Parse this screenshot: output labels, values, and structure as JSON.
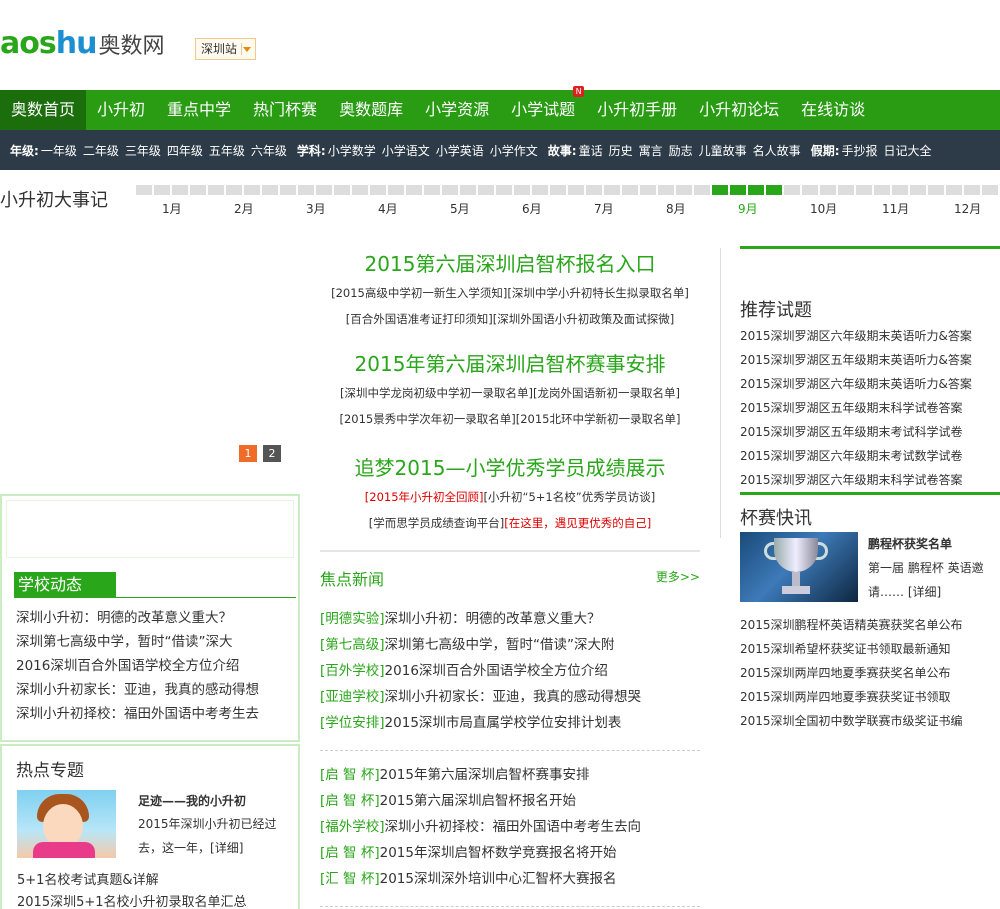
{
  "header": {
    "logo_en_a": "aos",
    "logo_en_b": "hu",
    "logo_cn": "奥数网",
    "station": "深圳站"
  },
  "nav": {
    "items": [
      "奥数首页",
      "小升初",
      "重点中学",
      "热门杯赛",
      "奥数题库",
      "小学资源",
      "小学试题",
      "小升初手册",
      "小升初论坛",
      "在线访谈"
    ],
    "badge": "N"
  },
  "subnav": {
    "grade_label": "年级:",
    "grades": [
      "一年级",
      "二年级",
      "三年级",
      "四年级",
      "五年级",
      "六年级"
    ],
    "subject_label": "学科:",
    "subjects": [
      "小学数学",
      "小学语文",
      "小学英语",
      "小学作文"
    ],
    "story_label": "故事:",
    "stories": [
      "童话",
      "历史",
      "寓言",
      "励志",
      "儿童故事",
      "名人故事"
    ],
    "holiday_label": "假期:",
    "holidays": [
      "手抄报",
      "日记大全"
    ]
  },
  "timeline": {
    "title": "小升初大事记",
    "months": [
      "1月",
      "2月",
      "3月",
      "4月",
      "5月",
      "6月",
      "7月",
      "8月",
      "9月",
      "10月",
      "11月",
      "12月"
    ],
    "current_month": "9月"
  },
  "carousel": {
    "pages": [
      "1",
      "2"
    ],
    "active": "1"
  },
  "headlines": [
    {
      "title": "2015第六届深圳启智杯报名入口",
      "links": [
        [
          "[2015高级中学初一新生入学须知]",
          "[深圳中学小升初特长生拟录取名单]"
        ],
        [
          "[百合外国语准考证打印须知]",
          "[深圳外国语小升初政策及面试探微]"
        ]
      ]
    },
    {
      "title": "2015年第六届深圳启智杯赛事安排",
      "links": [
        [
          "[深圳中学龙岗初级中学初一录取名单]",
          "[龙岗外国语新初一录取名单]"
        ],
        [
          "[2015景秀中学次年初一录取名单]",
          "[2015北环中学新初一录取名单]"
        ]
      ]
    },
    {
      "title": "追梦2015—小学优秀学员成绩展示",
      "links": [
        [
          "[2015年小升初全回顾]",
          "[小升初“5+1名校”优秀学员访谈]"
        ],
        [
          "[学而思学员成绩查询平台]",
          "[在这里，遇见更优秀的自己]"
        ]
      ]
    }
  ],
  "focus": {
    "title": "焦点新闻",
    "more": "更多>>",
    "group1": [
      {
        "tag": "[明德实验]",
        "text": "深圳小升初：明德的改革意义重大？"
      },
      {
        "tag": "[第七高级]",
        "text": "深圳第七高级中学，暂时“借读”深大附"
      },
      {
        "tag": "[百外学校]",
        "text": "2016深圳百合外国语学校全方位介绍"
      },
      {
        "tag": "[亚迪学校]",
        "text": "深圳小升初家长：亚迪，我真的感动得想哭"
      },
      {
        "tag": "[学位安排]",
        "text": "2015深圳市局直属学校学位安排计划表"
      }
    ],
    "group2": [
      {
        "tag": "[启 智 杯]",
        "text": "2015年第六届深圳启智杯赛事安排"
      },
      {
        "tag": "[启 智 杯]",
        "text": "2015第六届深圳启智杯报名开始"
      },
      {
        "tag": "[福外学校]",
        "text": "深圳小升初择校：福田外国语中考考生去向"
      },
      {
        "tag": "[启 智 杯]",
        "text": "2015年深圳启智杯数学竞赛报名将开始"
      },
      {
        "tag": "[汇 智 杯]",
        "text": "2015深圳深外培训中心汇智杯大赛报名"
      }
    ]
  },
  "recommend": {
    "title": "推荐试题",
    "items": [
      "2015深圳罗湖区六年级期末英语听力&答案",
      "2015深圳罗湖区五年级期末英语听力&答案",
      "2015深圳罗湖区六年级期末英语听力&答案",
      "2015深圳罗湖区五年级期末科学试卷答案",
      "2015深圳罗湖区五年级期末考试科学试卷",
      "2015深圳罗湖区六年级期末考试数学试卷",
      "2015深圳罗湖区六年级期末科学试卷答案"
    ]
  },
  "cup": {
    "title": "杯赛快讯",
    "feature_title": "鹏程杯获奖名单",
    "feature_desc": "第一届 鹏程杯 英语邀请…… ",
    "feature_more": "[详细]",
    "items": [
      "2015深圳鹏程杯英语精英赛获奖名单公布",
      "2015深圳希望杯获奖证书领取最新通知",
      "2015深圳两岸四地夏季赛获奖名单公布",
      "2015深圳两岸四地夏季赛获奖证书领取",
      "2015深圳全国初中数学联赛市级奖证书编"
    ]
  },
  "school": {
    "title": "学校动态",
    "items": [
      "深圳小升初：明德的改革意义重大？",
      "深圳第七高级中学，暂时“借读”深大",
      "2016深圳百合外国语学校全方位介绍",
      "深圳小升初家长：亚迪，我真的感动得想",
      "深圳小升初择校：福田外国语中考考生去"
    ]
  },
  "hot": {
    "title": "热点专题",
    "feature_title": "足迹——我的小升初",
    "feature_desc": "2015年深圳小升初已经过去，这一年，",
    "feature_more": "[详细]",
    "items": [
      "5+1名校考试真题&详解",
      "2015深圳5+1名校小升初录取名单汇总"
    ]
  },
  "colors": {
    "brand_green": "#2aa61b",
    "nav_active": "#1c6e0c",
    "subnav_bg": "#2d3b48",
    "pager_active": "#f06a28"
  }
}
